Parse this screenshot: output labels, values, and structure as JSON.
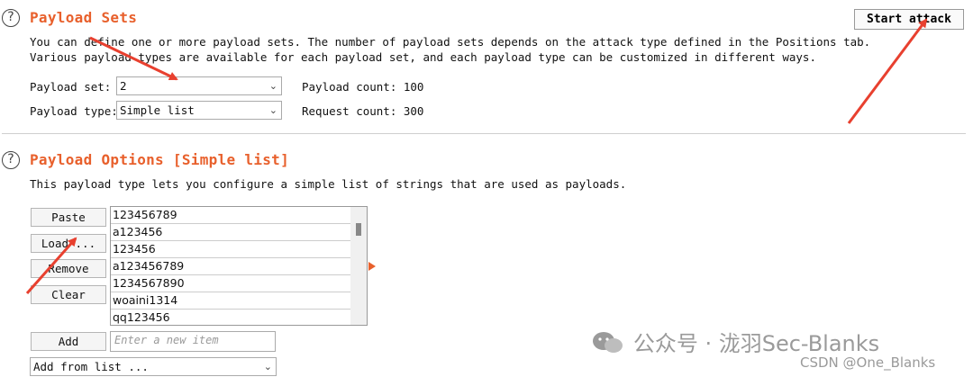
{
  "payload_sets": {
    "help": "?",
    "title": "Payload Sets",
    "description_line1": "You can define one or more payload sets. The number of payload sets depends on the attack type defined in the Positions tab.",
    "description_line2": "Various payload types are available for each payload set, and each payload type can be customized in different ways.",
    "set_label": "Payload set:",
    "set_value": "2",
    "type_label": "Payload type:",
    "type_value": "Simple list",
    "payload_count": "Payload count: 100",
    "request_count": "Request count: 300",
    "start_attack": "Start attack"
  },
  "payload_options": {
    "help": "?",
    "title": "Payload Options [Simple list]",
    "description": "This payload type lets you configure a simple list of strings that are used as payloads.",
    "buttons": {
      "paste": "Paste",
      "load": "Load ...",
      "remove": "Remove",
      "clear": "Clear",
      "add": "Add"
    },
    "items": [
      "123456789",
      "a123456",
      "123456",
      "a123456789",
      "1234567890",
      "woaini1314",
      "qq123456"
    ],
    "new_item_placeholder": "Enter a new item",
    "add_from_list": "Add from list ..."
  },
  "watermark": {
    "wechat": "公众号 · 泷羽Sec-Blanks",
    "csdn": "CSDN @One_Blanks"
  },
  "colors": {
    "accent": "#e8602c",
    "annotation_arrow": "#e8402f"
  }
}
